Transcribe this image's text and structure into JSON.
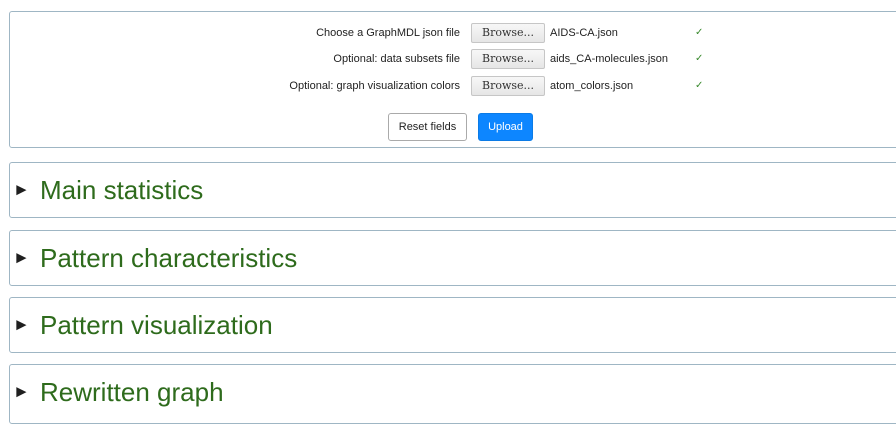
{
  "upload_panel": {
    "rows": [
      {
        "label": "Choose a GraphMDL json file",
        "browse_label": "Browse...",
        "file_name": "AIDS-CA.json",
        "status": "✓"
      },
      {
        "label": "Optional: data subsets file",
        "browse_label": "Browse...",
        "file_name": "aids_CA-molecules.json",
        "status": "✓"
      },
      {
        "label": "Optional: graph visualization colors",
        "browse_label": "Browse...",
        "file_name": "atom_colors.json",
        "status": "✓"
      }
    ],
    "reset_label": "Reset fields",
    "upload_label": "Upload"
  },
  "sections": [
    {
      "arrow": "►",
      "title": "Main statistics"
    },
    {
      "arrow": "►",
      "title": "Pattern characteristics"
    },
    {
      "arrow": "►",
      "title": "Pattern visualization"
    },
    {
      "arrow": "►",
      "title": "Rewritten graph"
    }
  ],
  "colors": {
    "section_title": "#2e6b1c",
    "upload_button": "#0d86ff",
    "check": "#3a8a2e",
    "border": "#9fb6c4"
  }
}
